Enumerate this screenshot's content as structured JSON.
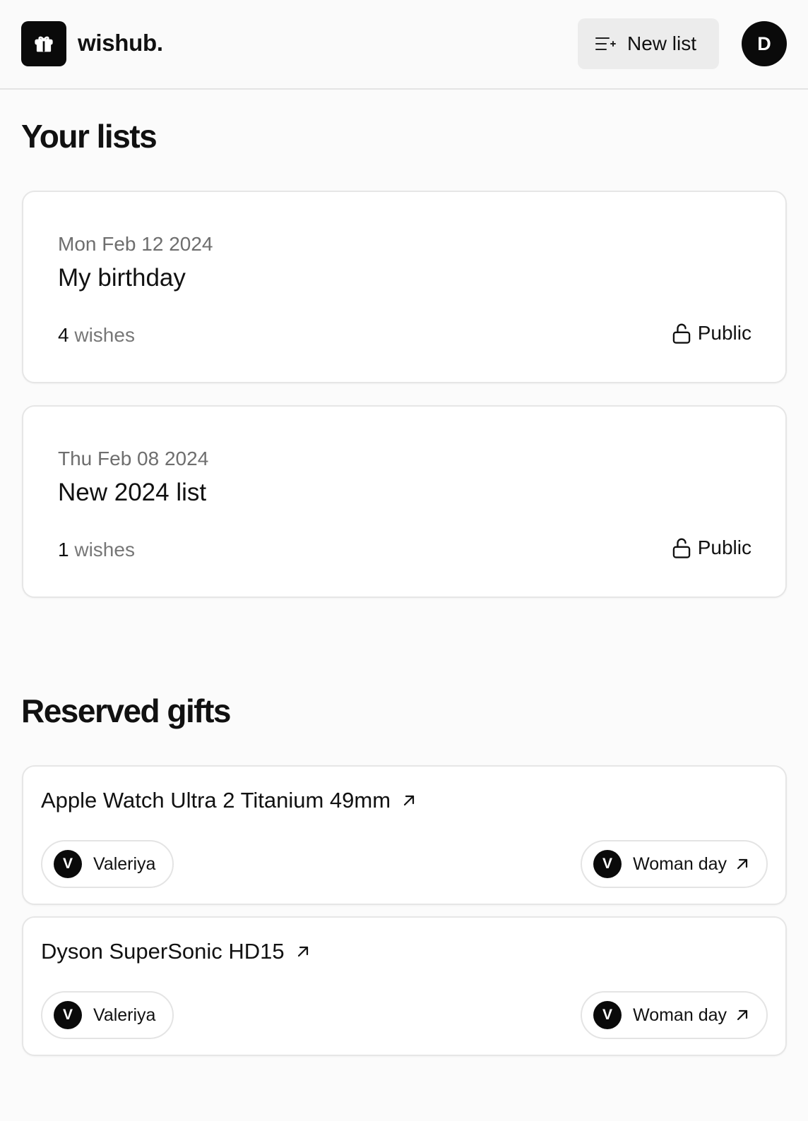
{
  "header": {
    "app_name": "wishub.",
    "new_list_label": "New list",
    "user_initial": "D"
  },
  "lists_section": {
    "title": "Your lists",
    "items": [
      {
        "date": "Mon Feb 12 2024",
        "name": "My birthday",
        "count": "4",
        "count_suffix": "wishes",
        "visibility": "Public"
      },
      {
        "date": "Thu Feb 08 2024",
        "name": "New 2024 list",
        "count": "1",
        "count_suffix": "wishes",
        "visibility": "Public"
      }
    ]
  },
  "reserved_section": {
    "title": "Reserved gifts",
    "items": [
      {
        "name": "Apple Watch Ultra 2 Titanium 49mm",
        "owner_initial": "V",
        "owner_name": "Valeriya",
        "list_initial": "V",
        "list_name": "Woman day"
      },
      {
        "name": "Dyson SuperSonic HD15",
        "owner_initial": "V",
        "owner_name": "Valeriya",
        "list_initial": "V",
        "list_name": "Woman day"
      }
    ]
  },
  "icons": {
    "logo": "gift-icon",
    "new_list": "list-plus-icon",
    "visibility": "unlock-icon",
    "external": "arrow-up-right-icon"
  },
  "colors": {
    "accent": "#0a0a0a",
    "background": "#fbfbfb",
    "muted_text": "#6e6e6e",
    "button_bg": "#ececec"
  }
}
